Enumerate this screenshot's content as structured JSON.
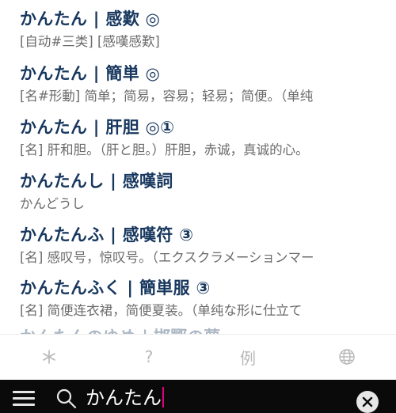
{
  "results": [
    {
      "headword": "かんたん | 感歎 ◎",
      "gloss": "[自动#三类] [感嘆感歎]"
    },
    {
      "headword": "かんたん | 簡単 ◎",
      "gloss": "[名#形動] 简单；简易，容易；轻易；简便。（单纯"
    },
    {
      "headword": "かんたん | 肝胆 ◎①",
      "gloss": "[名] 肝和胆。（肝と胆。）肝胆，赤诚，真诚的心。"
    },
    {
      "headword": "かんたんし | 感嘆詞",
      "gloss": "かんどうし"
    },
    {
      "headword": "かんたんふ | 感嘆符 ③",
      "gloss": "[名] 感叹号，惊叹号。（エクスクラメーションマー"
    },
    {
      "headword": "かんたんふく | 簡単服 ③",
      "gloss": "[名] 简便连衣裙，简便夏装。（单纯な形に仕立て"
    }
  ],
  "partial_row": "かんたんのゆめ | 邯鄲の夢",
  "tabs": [
    {
      "name": "tab-wildcard",
      "icon": "asterisk-icon",
      "glyph": "✳"
    },
    {
      "name": "tab-help",
      "icon": "question-icon",
      "glyph": "?"
    },
    {
      "name": "tab-examples",
      "icon": "example-icon",
      "glyph": "例"
    },
    {
      "name": "tab-web",
      "icon": "globe-icon",
      "glyph": "globe"
    }
  ],
  "search": {
    "value": "かんたん"
  },
  "colors": {
    "headword": "#17375e",
    "gloss": "#6b6b6b",
    "bar": "#0a0a0a",
    "caret": "#e6007e"
  }
}
